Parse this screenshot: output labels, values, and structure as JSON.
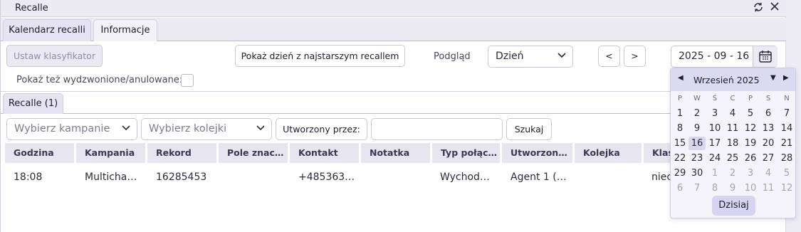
{
  "window": {
    "title": "Recalle",
    "refresh_icon": "refresh-icon",
    "close_icon": "close-icon"
  },
  "tabs": [
    {
      "label": "Kalendarz recalli",
      "active": true
    },
    {
      "label": "Informacje",
      "active": false
    }
  ],
  "toolbar": {
    "set_classifier": "Ustaw klasyfikator",
    "show_oldest": "Pokaż dzień z najstarszym recallem",
    "preview_label": "Podgląd",
    "preview_value": "Dzień",
    "prev": "<",
    "next": ">",
    "date": "2025 - 09 - 16",
    "show_cancelled": "Pokaż też wydzwonione/anulowane:"
  },
  "subtab": {
    "label": "Recalle (1)"
  },
  "filters": {
    "campaign_placeholder": "Wybierz kampanie",
    "queue_placeholder": "Wybierz kolejki",
    "created_by": "Utworzony przez:",
    "search": "Szukaj"
  },
  "table": {
    "headers": [
      "Godzina",
      "Kampania",
      "Rekord",
      "Pole znac…",
      "Kontakt",
      "Notatka",
      "Typ połąc…",
      "Utworzon…",
      "Kolejka",
      "Klas"
    ],
    "rows": [
      [
        "18:08",
        "Multicha…",
        "16285453",
        "",
        "+485363…",
        "",
        "Wychod…",
        "Agent 1 (…",
        "",
        "niec"
      ]
    ]
  },
  "calendar": {
    "month_label": "Wrzesień 2025",
    "weekdays": [
      "P",
      "W",
      "Ś",
      "C",
      "P",
      "S",
      "N"
    ],
    "weeks": [
      [
        "1",
        "2",
        "3",
        "4",
        "5",
        "6",
        "7"
      ],
      [
        "8",
        "9",
        "10",
        "11",
        "12",
        "13",
        "14"
      ],
      [
        "15",
        "16",
        "17",
        "18",
        "19",
        "20",
        "21"
      ],
      [
        "22",
        "23",
        "24",
        "25",
        "26",
        "27",
        "28"
      ],
      [
        "29",
        "30",
        "1",
        "2",
        "3",
        "4",
        "5"
      ],
      [
        "6",
        "7",
        "8",
        "9",
        "10",
        "11",
        "12"
      ]
    ],
    "selected_day": "16",
    "today_button": "Dzisiaj"
  },
  "colors": {
    "accent": "#dcdaf0",
    "header_bg": "#e6e5f0",
    "selected_day": "#d9d7ec"
  }
}
